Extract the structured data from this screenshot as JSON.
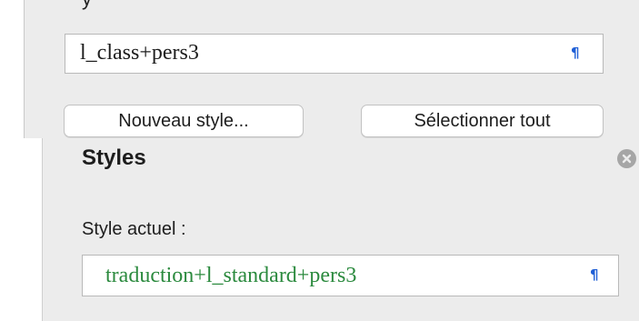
{
  "top_panel": {
    "current_style_value": "l_class+pers3",
    "pilcrow": "¶",
    "new_style_button": "Nouveau style...",
    "select_all_button": "Sélectionner tout"
  },
  "styles_panel": {
    "title": "Styles",
    "current_style_label": "Style actuel :",
    "current_style_value": "traduction+l_standard+pers3",
    "pilcrow": "¶"
  },
  "colors": {
    "panel_background": "#ececec",
    "pilcrow": "#1f5fd6",
    "current_style_text": "#2b8a3e",
    "close_button": "#a6a6a6"
  },
  "icons": {
    "pilcrow": "pilcrow-icon",
    "close": "close-icon"
  }
}
